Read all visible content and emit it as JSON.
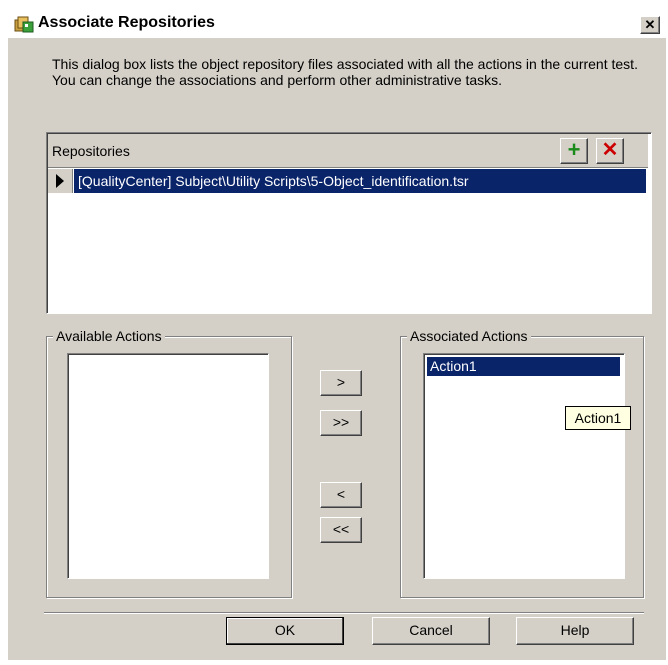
{
  "window": {
    "title": "Associate Repositories",
    "close_glyph": "✕"
  },
  "description": "This dialog box lists the object repository files associated with all the actions in the current test. You can change the associations and perform other administrative tasks.",
  "repositories": {
    "header": "Repositories",
    "add_glyph": "+",
    "delete_glyph": "✕",
    "items": [
      "[QualityCenter]  Subject\\Utility  Scripts\\5-Object_identification.tsr"
    ]
  },
  "available_actions": {
    "label": "Available Actions",
    "items": []
  },
  "associated_actions": {
    "label": "Associated Actions",
    "items": [
      "Action1"
    ],
    "tooltip": "Action1"
  },
  "move_buttons": {
    "add": ">",
    "add_all": ">>",
    "remove": "<",
    "remove_all": "<<"
  },
  "footer": {
    "ok": "OK",
    "cancel": "Cancel",
    "help": "Help"
  },
  "colors": {
    "dialog_bg": "#d4d0c8",
    "selection": "#0a246a",
    "tooltip_bg": "#ffffe1",
    "add_green": "#1a8a1a",
    "delete_red": "#cc0000"
  },
  "icons": [
    "app-icon",
    "close-icon",
    "add-icon",
    "delete-icon",
    "row-pointer-icon"
  ]
}
